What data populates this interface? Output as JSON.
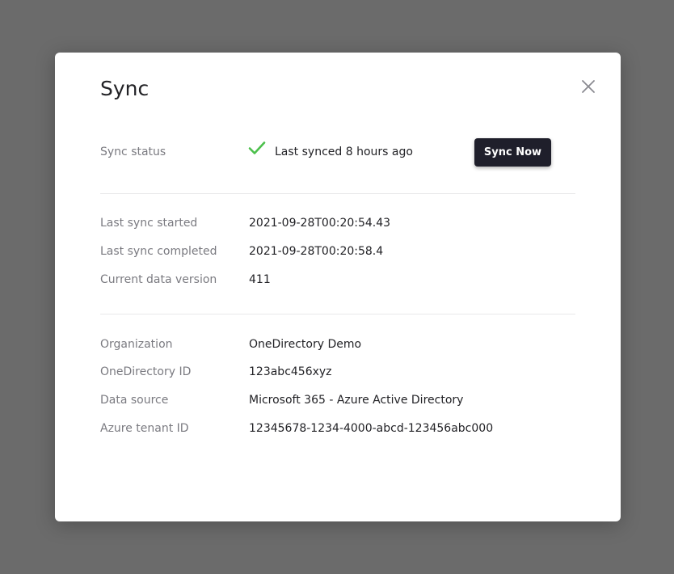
{
  "modal": {
    "title": "Sync"
  },
  "sync_status": {
    "label": "Sync status",
    "value": "Last synced 8 hours ago",
    "button_label": "Sync Now",
    "status_color": "#4cc04c"
  },
  "sync_details": [
    {
      "label": "Last sync started",
      "value": "2021-09-28T00:20:54.43"
    },
    {
      "label": "Last sync completed",
      "value": "2021-09-28T00:20:58.4"
    },
    {
      "label": "Current data version",
      "value": "411"
    }
  ],
  "org_details": [
    {
      "label": "Organization",
      "value": "OneDirectory Demo"
    },
    {
      "label": "OneDirectory ID",
      "value": "123abc456xyz"
    },
    {
      "label": "Data source",
      "value": "Microsoft 365 - Azure Active Directory"
    },
    {
      "label": "Azure tenant ID",
      "value": "12345678-1234-4000-abcd-123456abc000"
    }
  ],
  "icons": {
    "close": "close-icon",
    "status": "checkmark-icon"
  }
}
